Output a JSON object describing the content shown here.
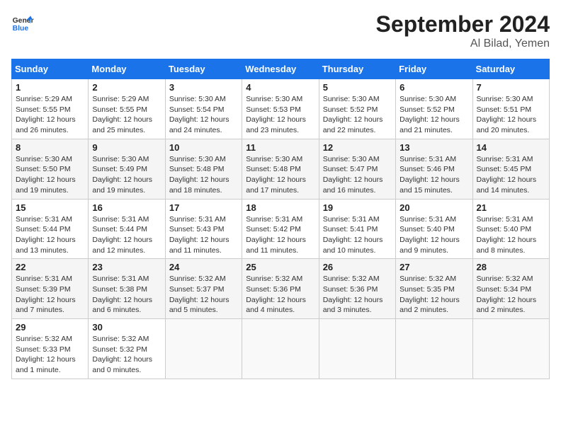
{
  "header": {
    "logo_line1": "General",
    "logo_line2": "Blue",
    "month": "September 2024",
    "location": "Al Bilad, Yemen"
  },
  "days_of_week": [
    "Sunday",
    "Monday",
    "Tuesday",
    "Wednesday",
    "Thursday",
    "Friday",
    "Saturday"
  ],
  "weeks": [
    [
      {
        "day": "1",
        "detail": "Sunrise: 5:29 AM\nSunset: 5:55 PM\nDaylight: 12 hours\nand 26 minutes."
      },
      {
        "day": "2",
        "detail": "Sunrise: 5:29 AM\nSunset: 5:55 PM\nDaylight: 12 hours\nand 25 minutes."
      },
      {
        "day": "3",
        "detail": "Sunrise: 5:30 AM\nSunset: 5:54 PM\nDaylight: 12 hours\nand 24 minutes."
      },
      {
        "day": "4",
        "detail": "Sunrise: 5:30 AM\nSunset: 5:53 PM\nDaylight: 12 hours\nand 23 minutes."
      },
      {
        "day": "5",
        "detail": "Sunrise: 5:30 AM\nSunset: 5:52 PM\nDaylight: 12 hours\nand 22 minutes."
      },
      {
        "day": "6",
        "detail": "Sunrise: 5:30 AM\nSunset: 5:52 PM\nDaylight: 12 hours\nand 21 minutes."
      },
      {
        "day": "7",
        "detail": "Sunrise: 5:30 AM\nSunset: 5:51 PM\nDaylight: 12 hours\nand 20 minutes."
      }
    ],
    [
      {
        "day": "8",
        "detail": "Sunrise: 5:30 AM\nSunset: 5:50 PM\nDaylight: 12 hours\nand 19 minutes."
      },
      {
        "day": "9",
        "detail": "Sunrise: 5:30 AM\nSunset: 5:49 PM\nDaylight: 12 hours\nand 19 minutes."
      },
      {
        "day": "10",
        "detail": "Sunrise: 5:30 AM\nSunset: 5:48 PM\nDaylight: 12 hours\nand 18 minutes."
      },
      {
        "day": "11",
        "detail": "Sunrise: 5:30 AM\nSunset: 5:48 PM\nDaylight: 12 hours\nand 17 minutes."
      },
      {
        "day": "12",
        "detail": "Sunrise: 5:30 AM\nSunset: 5:47 PM\nDaylight: 12 hours\nand 16 minutes."
      },
      {
        "day": "13",
        "detail": "Sunrise: 5:31 AM\nSunset: 5:46 PM\nDaylight: 12 hours\nand 15 minutes."
      },
      {
        "day": "14",
        "detail": "Sunrise: 5:31 AM\nSunset: 5:45 PM\nDaylight: 12 hours\nand 14 minutes."
      }
    ],
    [
      {
        "day": "15",
        "detail": "Sunrise: 5:31 AM\nSunset: 5:44 PM\nDaylight: 12 hours\nand 13 minutes."
      },
      {
        "day": "16",
        "detail": "Sunrise: 5:31 AM\nSunset: 5:44 PM\nDaylight: 12 hours\nand 12 minutes."
      },
      {
        "day": "17",
        "detail": "Sunrise: 5:31 AM\nSunset: 5:43 PM\nDaylight: 12 hours\nand 11 minutes."
      },
      {
        "day": "18",
        "detail": "Sunrise: 5:31 AM\nSunset: 5:42 PM\nDaylight: 12 hours\nand 11 minutes."
      },
      {
        "day": "19",
        "detail": "Sunrise: 5:31 AM\nSunset: 5:41 PM\nDaylight: 12 hours\nand 10 minutes."
      },
      {
        "day": "20",
        "detail": "Sunrise: 5:31 AM\nSunset: 5:40 PM\nDaylight: 12 hours\nand 9 minutes."
      },
      {
        "day": "21",
        "detail": "Sunrise: 5:31 AM\nSunset: 5:40 PM\nDaylight: 12 hours\nand 8 minutes."
      }
    ],
    [
      {
        "day": "22",
        "detail": "Sunrise: 5:31 AM\nSunset: 5:39 PM\nDaylight: 12 hours\nand 7 minutes."
      },
      {
        "day": "23",
        "detail": "Sunrise: 5:31 AM\nSunset: 5:38 PM\nDaylight: 12 hours\nand 6 minutes."
      },
      {
        "day": "24",
        "detail": "Sunrise: 5:32 AM\nSunset: 5:37 PM\nDaylight: 12 hours\nand 5 minutes."
      },
      {
        "day": "25",
        "detail": "Sunrise: 5:32 AM\nSunset: 5:36 PM\nDaylight: 12 hours\nand 4 minutes."
      },
      {
        "day": "26",
        "detail": "Sunrise: 5:32 AM\nSunset: 5:36 PM\nDaylight: 12 hours\nand 3 minutes."
      },
      {
        "day": "27",
        "detail": "Sunrise: 5:32 AM\nSunset: 5:35 PM\nDaylight: 12 hours\nand 2 minutes."
      },
      {
        "day": "28",
        "detail": "Sunrise: 5:32 AM\nSunset: 5:34 PM\nDaylight: 12 hours\nand 2 minutes."
      }
    ],
    [
      {
        "day": "29",
        "detail": "Sunrise: 5:32 AM\nSunset: 5:33 PM\nDaylight: 12 hours\nand 1 minute."
      },
      {
        "day": "30",
        "detail": "Sunrise: 5:32 AM\nSunset: 5:32 PM\nDaylight: 12 hours\nand 0 minutes."
      },
      {
        "day": "",
        "detail": ""
      },
      {
        "day": "",
        "detail": ""
      },
      {
        "day": "",
        "detail": ""
      },
      {
        "day": "",
        "detail": ""
      },
      {
        "day": "",
        "detail": ""
      }
    ]
  ]
}
